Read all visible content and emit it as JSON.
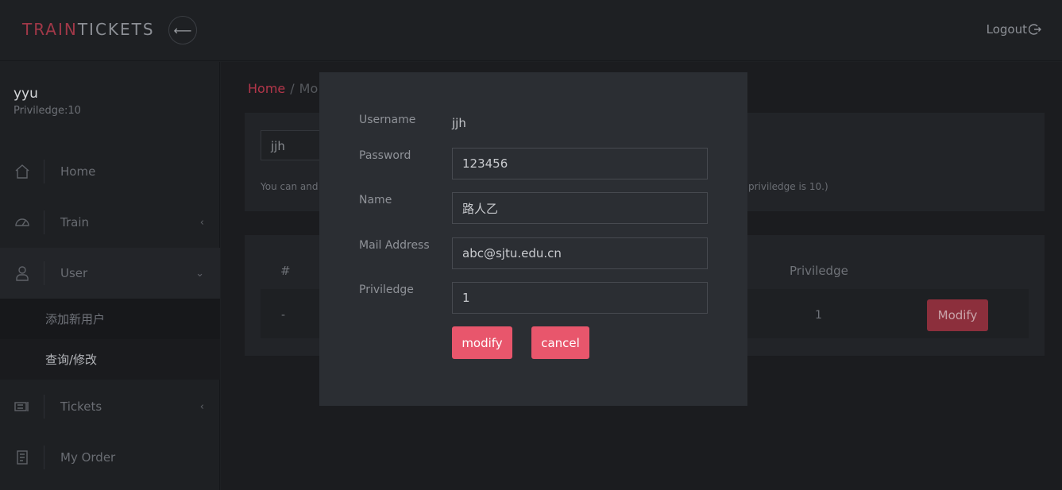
{
  "header": {
    "logo_part1": "TRAIN",
    "logo_part2": "TICKETS",
    "back_glyph": "⟵",
    "logout_label": "Logout",
    "logout_icon": "logout-icon"
  },
  "sidebar": {
    "user_name": "yyu",
    "user_priv": "Priviledge:10",
    "items": [
      {
        "label": "Home",
        "icon": "home-icon"
      },
      {
        "label": "Train",
        "icon": "gauge-icon",
        "chevron": "‹"
      },
      {
        "label": "User",
        "icon": "user-icon",
        "chevron": "⌄"
      },
      {
        "label": "Tickets",
        "icon": "ticket-icon",
        "chevron": "‹"
      },
      {
        "label": "My Order",
        "icon": "order-icon"
      }
    ],
    "subitems": [
      {
        "label": "添加新用户"
      },
      {
        "label": "查询/修改"
      }
    ]
  },
  "main": {
    "breadcrumb_home": "Home",
    "breadcrumb_sep": "/",
    "breadcrumb_current": "Mo",
    "search_value": "jjh",
    "hint_left": "You can and",
    "hint_right": "priviledge is 10.)",
    "table": {
      "headers": [
        "#",
        "Priviledge"
      ],
      "row": {
        "index": "-",
        "priviledge": "1",
        "action": "Modify"
      }
    }
  },
  "modal": {
    "username_label": "Username",
    "username_value": "jjh",
    "password_label": "Password",
    "password_value": "123456",
    "name_label": "Name",
    "name_value": "路人乙",
    "mail_label": "Mail Address",
    "mail_value": "abc@sjtu.edu.cn",
    "priv_label": "Priviledge",
    "priv_value": "1",
    "modify_label": "modify",
    "cancel_label": "cancel"
  },
  "colors": {
    "accent": "#e8566c",
    "brand_red": "#a13848",
    "background": "#1e2023",
    "modal_bg": "#2b2e33"
  }
}
